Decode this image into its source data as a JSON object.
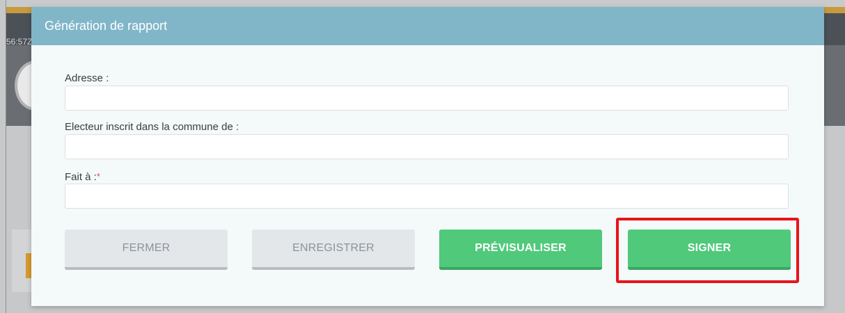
{
  "background": {
    "time_fragment": "56:57Z"
  },
  "modal": {
    "title": "Génération de rapport",
    "fields": [
      {
        "label": "Adresse :",
        "value": "",
        "placeholder": "",
        "required": false
      },
      {
        "label": "Electeur inscrit dans la commune de :",
        "value": "",
        "placeholder": "",
        "required": false
      },
      {
        "label": "Fait à :",
        "value": "",
        "placeholder": "",
        "required": true,
        "required_mark": "*"
      }
    ],
    "buttons": {
      "close": "FERMER",
      "save": "ENREGISTRER",
      "preview": "PRÉVISUALISER",
      "sign": "SIGNER"
    }
  },
  "colors": {
    "header": "#80b6c8",
    "primary_green": "#50c97b",
    "secondary_grey": "#e3e7ea",
    "highlight_red": "#e8141a",
    "required_red": "#e05050"
  },
  "icons": []
}
